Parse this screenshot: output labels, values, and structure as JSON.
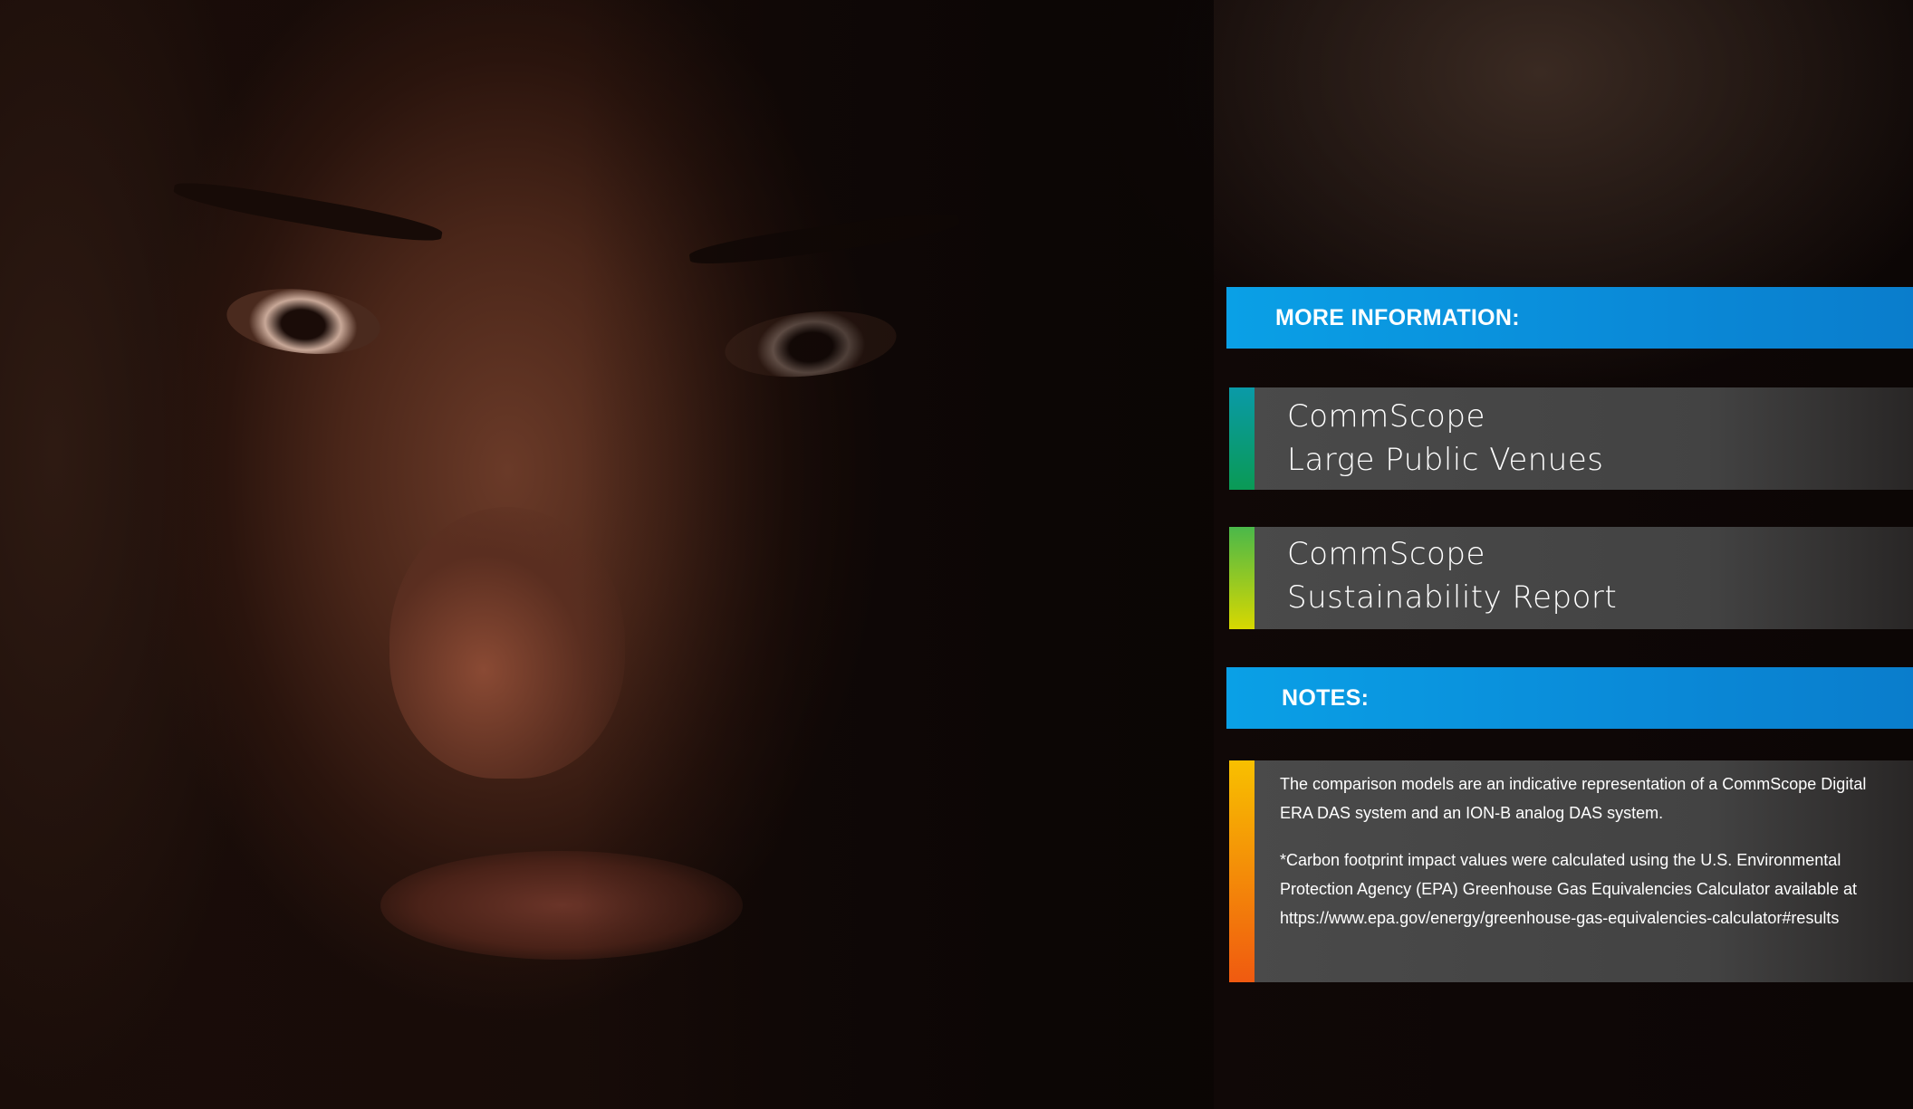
{
  "more_info": {
    "heading": "MORE INFORMATION:"
  },
  "links": [
    {
      "line1": "CommScope",
      "line2": "Large Public Venues"
    },
    {
      "line1": "CommScope",
      "line2": "Sustainability Report"
    }
  ],
  "notes": {
    "heading": "NOTES:",
    "paragraph1": "The comparison models are an indicative representation of a CommScope Digital ERA DAS system and an ION-B analog DAS system.",
    "paragraph2": "*Carbon footprint impact values were calculated using the U.S. Environmental Protection Agency (EPA) Greenhouse Gas Equivalencies Calculator available at https://www.epa.gov/energy/greenhouse-gas-equivalencies-calculator#results"
  },
  "colors": {
    "band_blue": "#0a8ad8",
    "card_gray": "#474747",
    "accent_teal_top": "#0a9aa8",
    "accent_teal_bottom": "#0a9a55",
    "accent_green_top": "#4ab84a",
    "accent_green_bottom": "#d8d800",
    "accent_orange_top": "#f8c000",
    "accent_orange_bottom": "#f05a10"
  }
}
